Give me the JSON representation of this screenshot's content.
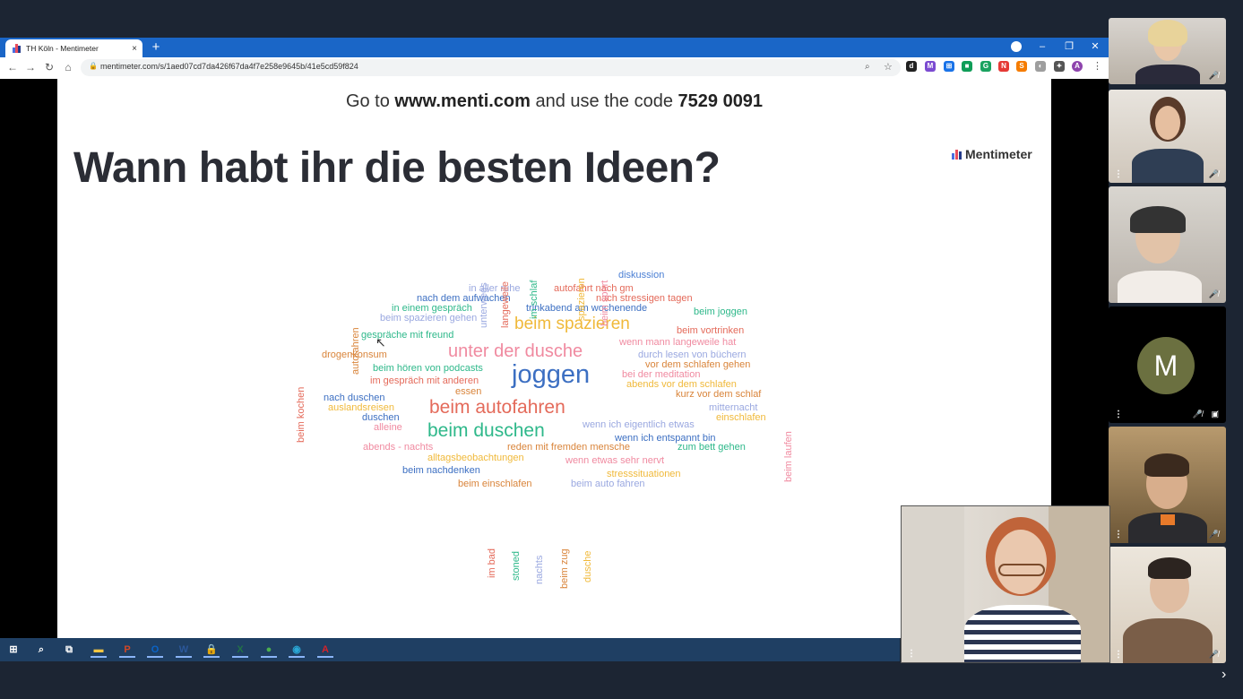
{
  "browser": {
    "tab_title": "TH Köln - Mentimeter",
    "tab_close": "×",
    "new_tab": "+",
    "url": "mentimeter.com/s/1aed07cd7da426f67da4f7e258e9645b/41e5cd59f824",
    "window_controls": [
      "–",
      "❐",
      "✕"
    ],
    "nav": {
      "back": "←",
      "forward": "→",
      "reload": "↻",
      "home": "⌂"
    },
    "extensions": [
      {
        "label": "d",
        "color": "#222222"
      },
      {
        "label": "M",
        "color": "#7b4bd1"
      },
      {
        "label": "⊞",
        "color": "#1a73e8"
      },
      {
        "label": "■",
        "color": "#0f9d58"
      },
      {
        "label": "G",
        "color": "#1aa260"
      },
      {
        "label": "N",
        "color": "#e53935"
      },
      {
        "label": "S",
        "color": "#f57c00"
      },
      {
        "label": "◐",
        "color": "#9e9e9e"
      },
      {
        "label": "✦",
        "color": "#555555"
      },
      {
        "label": "A",
        "color": "#8e44ad"
      }
    ]
  },
  "slide": {
    "join_prefix": "Go to ",
    "join_url": "www.menti.com",
    "join_middle": " and use the code ",
    "join_code": "7529 0091",
    "question": "Wann habt ihr die besten Ideen?",
    "brand": "Mentimeter",
    "brand_colors": [
      "#4a6ee0",
      "#e84c5c",
      "#233a8a"
    ]
  },
  "word_cloud": {
    "horizontal": [
      {
        "text": "diskussion",
        "color": "#4a7fd4"
      },
      {
        "text": "in aller ruhe",
        "color": "#9aa8e0"
      },
      {
        "text": "autofahrt nach gm",
        "color": "#e46a5a"
      },
      {
        "text": "nach dem aufwachen",
        "color": "#3c6fc2"
      },
      {
        "text": "nach stressigen tagen",
        "color": "#e46a5a"
      },
      {
        "text": "in einem gespräch",
        "color": "#2eb88a"
      },
      {
        "text": "trinkabend am wochenende",
        "color": "#3c6fc2"
      },
      {
        "text": "beim joggen",
        "color": "#2eb88a"
      },
      {
        "text": "beim spazieren gehen",
        "color": "#9aa8e0"
      },
      {
        "text": "beim spazieren",
        "color": "#f0b93a"
      },
      {
        "text": "gespräche mit freund",
        "color": "#2eb88a"
      },
      {
        "text": "beim vortrinken",
        "color": "#e46a5a"
      },
      {
        "text": "wenn mann langeweile hat",
        "color": "#f08aa0"
      },
      {
        "text": "unter der dusche",
        "color": "#f08aa0"
      },
      {
        "text": "drogenkonsum",
        "color": "#d9843a"
      },
      {
        "text": "durch lesen von büchern",
        "color": "#9aa8e0"
      },
      {
        "text": "vor dem schlafen gehen",
        "color": "#d9843a"
      },
      {
        "text": "beim hören von podcasts",
        "color": "#2eb88a"
      },
      {
        "text": "joggen",
        "color": "#3c6fc2"
      },
      {
        "text": "bei der meditation",
        "color": "#f08aa0"
      },
      {
        "text": "im gespräch mit anderen",
        "color": "#e46a5a"
      },
      {
        "text": "abends vor dem schlafen",
        "color": "#f0b93a"
      },
      {
        "text": "essen",
        "color": "#d9843a"
      },
      {
        "text": "kurz vor dem schlaf",
        "color": "#d9843a"
      },
      {
        "text": "nach duschen",
        "color": "#3c6fc2"
      },
      {
        "text": "auslandsreisen",
        "color": "#f0b93a"
      },
      {
        "text": "beim autofahren",
        "color": "#e46a5a"
      },
      {
        "text": "mitternacht",
        "color": "#9aa8e0"
      },
      {
        "text": "duschen",
        "color": "#3c6fc2"
      },
      {
        "text": "einschlafen",
        "color": "#f0b93a"
      },
      {
        "text": "wenn ich eigentlich etwas",
        "color": "#9aa8e0"
      },
      {
        "text": "alleine",
        "color": "#f08aa0"
      },
      {
        "text": "beim duschen",
        "color": "#2eb88a"
      },
      {
        "text": "wenn ich entspannt bin",
        "color": "#3c6fc2"
      },
      {
        "text": "abends - nachts",
        "color": "#f08aa0"
      },
      {
        "text": "reden mit fremden mensche",
        "color": "#d9843a"
      },
      {
        "text": "zum bett gehen",
        "color": "#2eb88a"
      },
      {
        "text": "alltagsbeobachtungen",
        "color": "#f0b93a"
      },
      {
        "text": "wenn etwas sehr nervt",
        "color": "#f08aa0"
      },
      {
        "text": "beim nachdenken",
        "color": "#3c6fc2"
      },
      {
        "text": "stresssituationen",
        "color": "#f0b93a"
      },
      {
        "text": "beim einschlafen",
        "color": "#d9843a"
      },
      {
        "text": "beim auto fahren",
        "color": "#9aa8e0"
      }
    ],
    "vertical": [
      {
        "text": "unterwegs",
        "color": "#9aa8e0"
      },
      {
        "text": "langeweile",
        "color": "#e46a5a"
      },
      {
        "text": "im schlaf",
        "color": "#2eb88a"
      },
      {
        "text": "spazieren",
        "color": "#f0b93a"
      },
      {
        "text": "beim sport",
        "color": "#f08aa0"
      },
      {
        "text": "autofahren",
        "color": "#d9843a"
      },
      {
        "text": "beim kochen",
        "color": "#e46a5a"
      },
      {
        "text": "beim laufen",
        "color": "#f08aa0"
      },
      {
        "text": "im bad",
        "color": "#e46a5a"
      },
      {
        "text": "stoned",
        "color": "#2eb88a"
      },
      {
        "text": "nachts",
        "color": "#9aa8e0"
      },
      {
        "text": "beim zug",
        "color": "#d9843a"
      },
      {
        "text": "dusche",
        "color": "#f0b93a"
      }
    ]
  },
  "taskbar": {
    "items": [
      {
        "name": "start-icon",
        "label": "⊞",
        "color": "#ffffff"
      },
      {
        "name": "search-icon",
        "label": "⌕",
        "color": "#ffffff"
      },
      {
        "name": "task-view-icon",
        "label": "⧉",
        "color": "#ffffff"
      },
      {
        "name": "file-explorer-icon",
        "label": "▬",
        "color": "#f4c542"
      },
      {
        "name": "powerpoint-icon",
        "label": "P",
        "color": "#d24726"
      },
      {
        "name": "outlook-icon",
        "label": "O",
        "color": "#0a64c8"
      },
      {
        "name": "word-icon",
        "label": "W",
        "color": "#2b579a"
      },
      {
        "name": "lock-app-icon",
        "label": "🔒",
        "color": "#f4c542"
      },
      {
        "name": "excel-icon",
        "label": "X",
        "color": "#217346"
      },
      {
        "name": "chrome-icon",
        "label": "●",
        "color": "#4caf50"
      },
      {
        "name": "app-circle-icon",
        "label": "◉",
        "color": "#2aa7d6"
      },
      {
        "name": "acrobat-icon",
        "label": "A",
        "color": "#d4232b"
      }
    ]
  },
  "participants": {
    "avatar_initial": "M",
    "mic_off": "🎤̸",
    "cam_off": "▣̸",
    "more": "⋮"
  },
  "panel_chevron": "›"
}
